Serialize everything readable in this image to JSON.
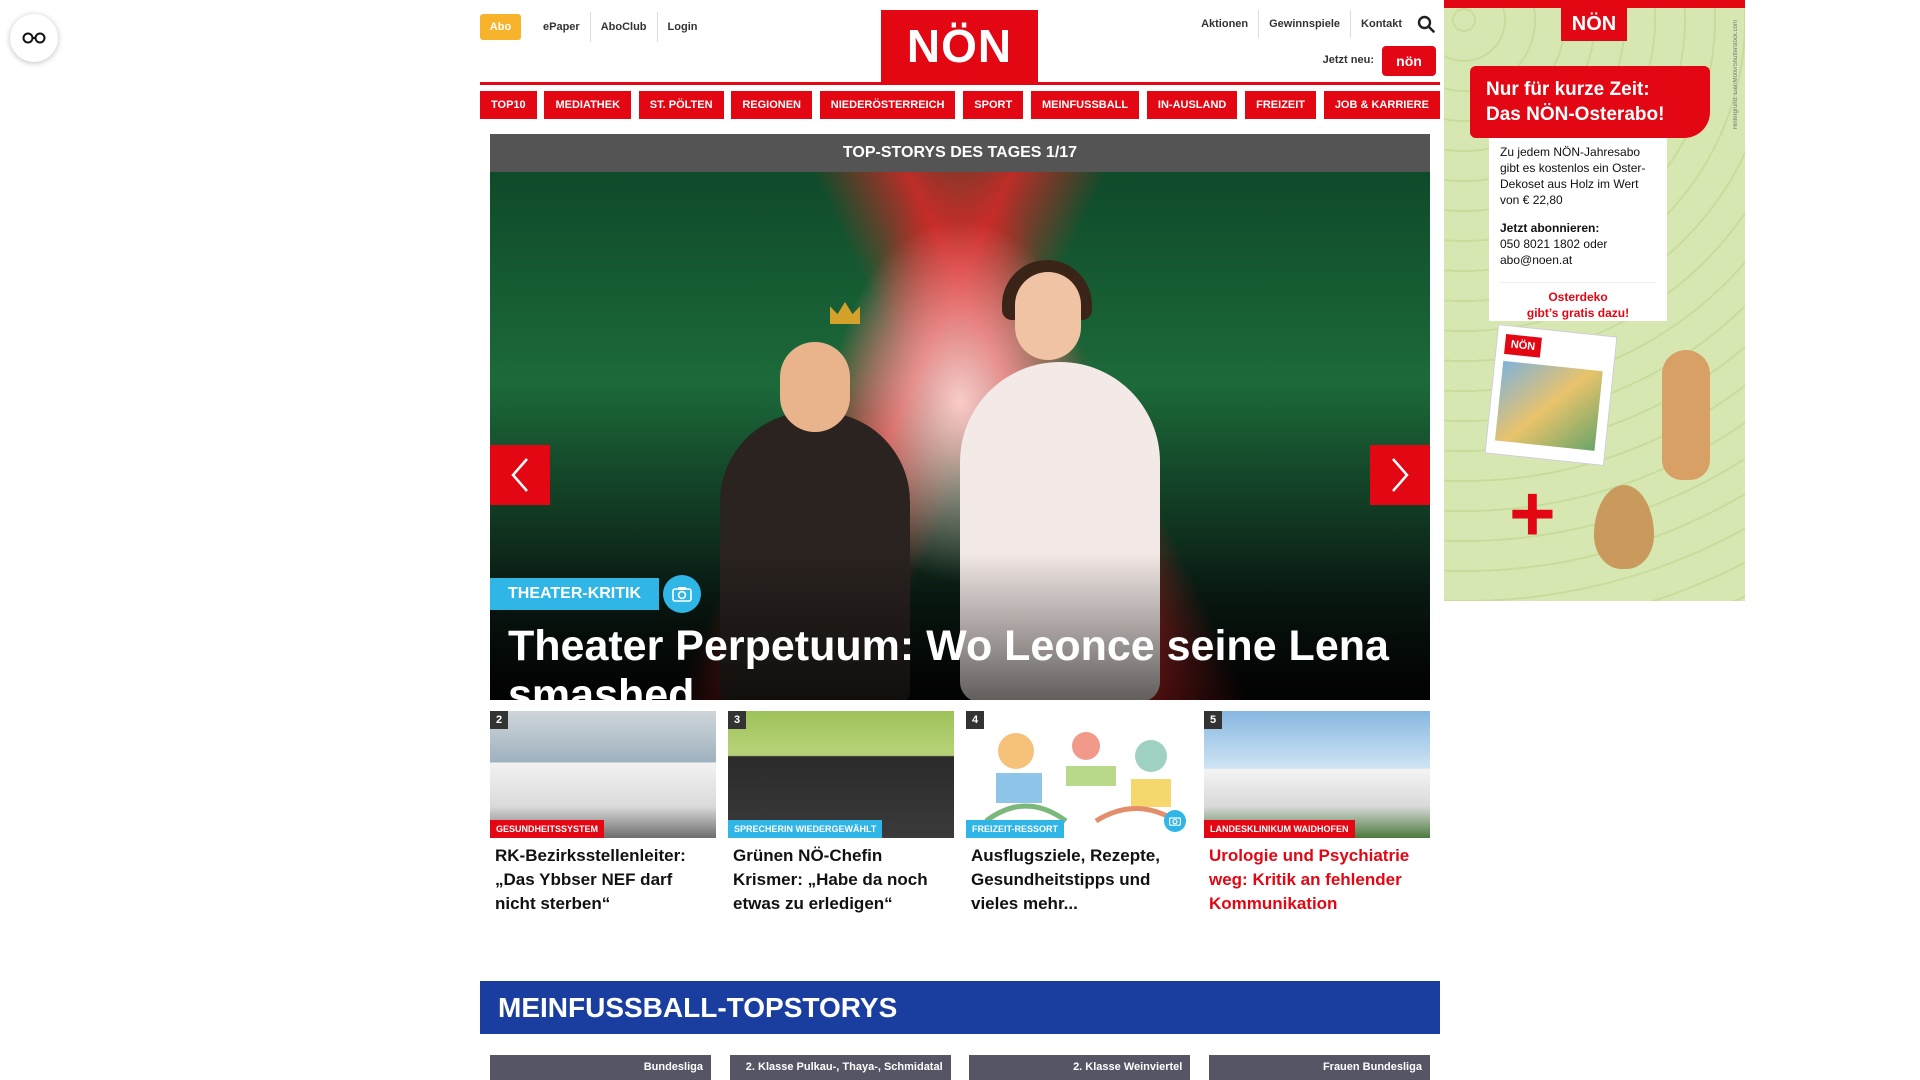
{
  "reader_button": {
    "icon": "glasses-icon"
  },
  "header": {
    "abo_label": "Abo",
    "links": [
      "ePaper",
      "AboClub",
      "Login"
    ],
    "logo_text": "NÖN",
    "right_links": [
      "Aktionen",
      "Gewinnspiele",
      "Kontakt"
    ],
    "search_icon": "search-icon",
    "jetzt_neu": "Jetzt neu:",
    "mini_logo_text": "nön"
  },
  "nav": {
    "items": [
      "TOP10",
      "MEDIATHEK",
      "ST. PÖLTEN",
      "REGIONEN",
      "NIEDERÖSTERREICH",
      "SPORT",
      "MEINFUSSBALL",
      "IN-AUSLAND",
      "FREIZEIT",
      "JOB & KARRIERE"
    ]
  },
  "colors": {
    "brand_red": "#e30613",
    "accent_blue": "#2fb5e6",
    "section_blue": "#1a3da0",
    "abo_yellow": "#f7b32b"
  },
  "hero": {
    "header": "TOP-STORYS DES TAGES 1/17",
    "kicker": "THEATER-KRITIK",
    "title": "Theater Perpetuum: Wo Leonce seine Lena smashed",
    "prev_icon": "chevron-left-icon",
    "next_icon": "chevron-right-icon",
    "camera_icon": "camera-icon"
  },
  "teasers": [
    {
      "num": "2",
      "tag": "GESUNDHEITSSYSTEM",
      "tag_color": "#e30613",
      "title": "RK-Bezirksstellenleiter: „Das Ybbser NEF darf nicht sterben“",
      "title_red": false
    },
    {
      "num": "3",
      "tag": "SPRECHERIN WIEDERGEWÄHLT",
      "tag_color": "#2fb5e6",
      "title": "Grünen NÖ-Chefin Krismer: „Habe da noch etwas zu erledigen“",
      "title_red": false
    },
    {
      "num": "4",
      "tag": "FREIZEIT-RESSORT",
      "tag_color": "#2fb5e6",
      "title": "Ausflugsziele, Rezepte, Gesundheitstipps und vieles mehr...",
      "title_red": false
    },
    {
      "num": "5",
      "tag": "LANDESKLINIKUM WAIDHOFEN",
      "tag_color": "#e30613",
      "title": "Urologie und Psychiatrie weg: Kritik an fehlender Kommunikation",
      "title_red": true
    }
  ],
  "section": {
    "title": "MEINFUSSBALL-TOPSTORYS",
    "cards": [
      "Bundesliga",
      "2. Klasse Pulkau-, Thaya-, Schmidatal",
      "2. Klasse Weinviertel",
      "Frauen Bundesliga"
    ]
  },
  "ad": {
    "logo_text": "NÖN",
    "headline_1": "Nur für kurze Zeit:",
    "headline_2": "Das NÖN-Osterabo!",
    "body": "Zu jedem NÖN-Jahresabo gibt es kostenlos ein Oster-Dekoset aus Holz im Wert von € 22,80",
    "cta_title": "Jetzt abonnieren:",
    "cta_phone": "050 8021 1802 oder",
    "cta_email": "abo@noen.at",
    "promo_1": "Osterdeko",
    "promo_2": "gibt’s gratis dazu!",
    "mag_logo": "NÖN",
    "plus": "+",
    "credit": "Hintergrund: Eier/Motiv/Shutterstock.com"
  }
}
